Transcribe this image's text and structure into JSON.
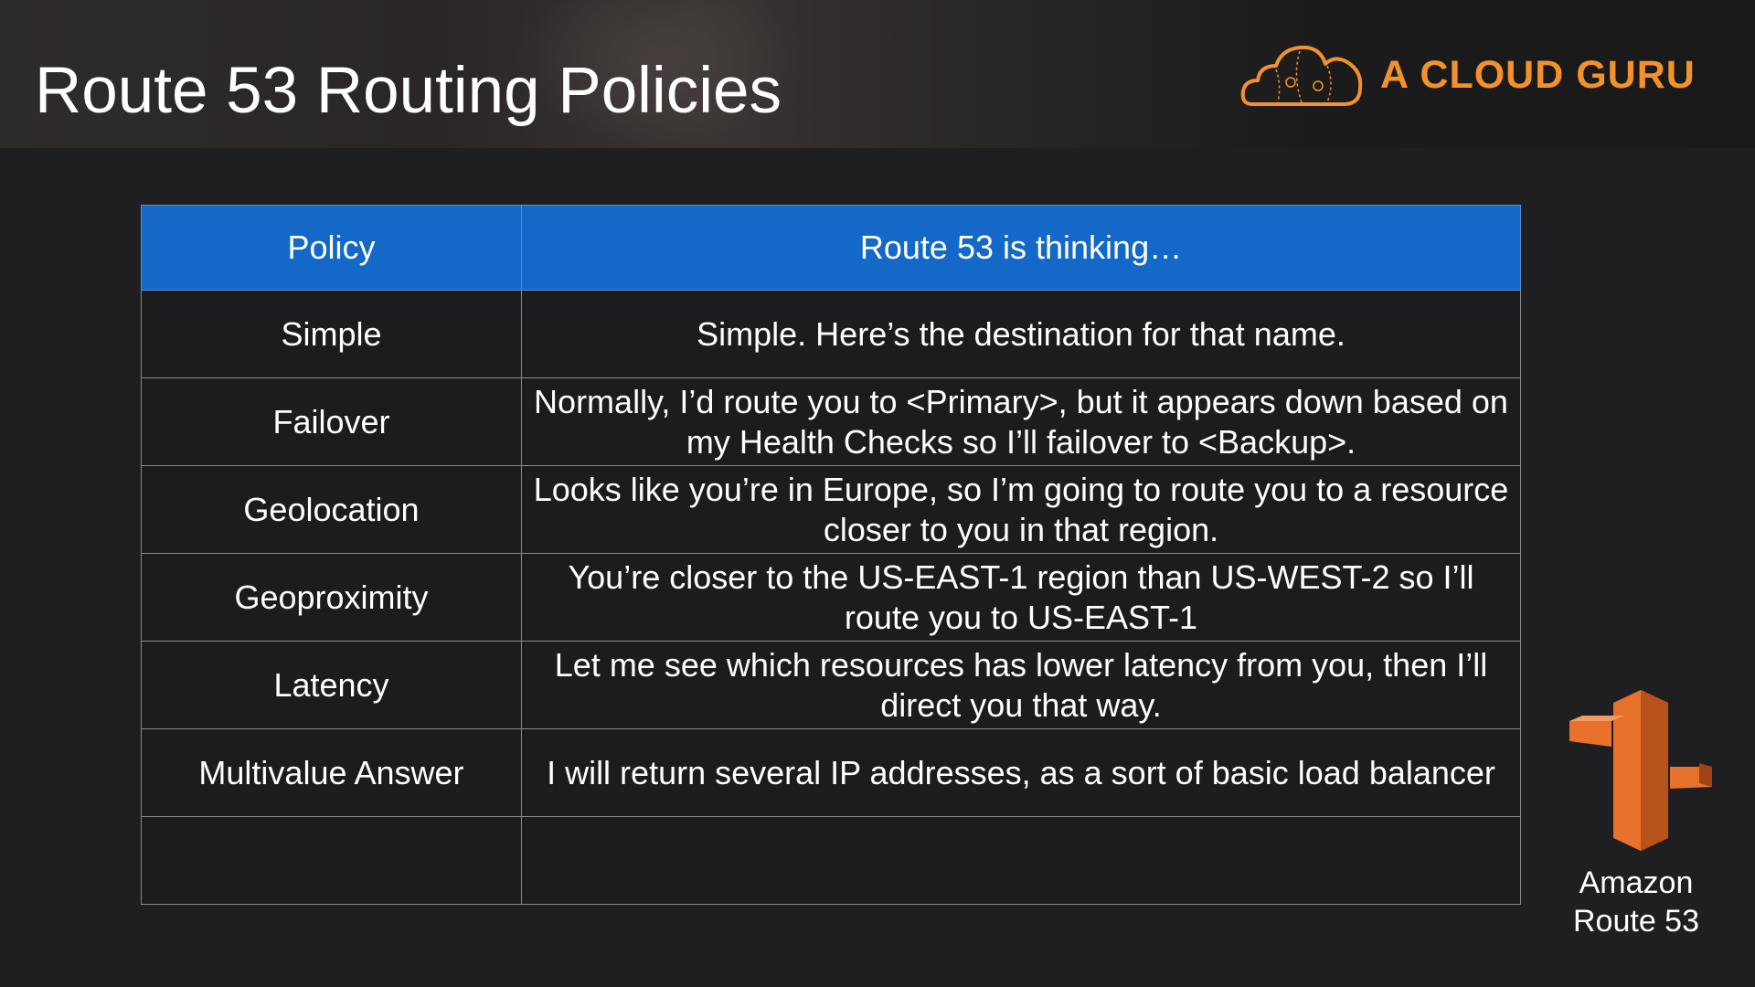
{
  "title": "Route 53 Routing Policies",
  "brand": {
    "name": "A CLOUD GURU",
    "color": "#f3922b",
    "icon": "cloud-logo-icon"
  },
  "table": {
    "headers": [
      "Policy",
      "Route 53 is thinking…"
    ],
    "header_color": "#1468c7",
    "rows": [
      {
        "policy": "Simple",
        "description": "Simple.  Here’s the destination for that name."
      },
      {
        "policy": "Failover",
        "description": "Normally, I’d route you to <Primary>, but it appears down based on my Health Checks so I’ll failover to <Backup>."
      },
      {
        "policy": "Geolocation",
        "description": "Looks like you’re in Europe, so I’m going to route you to a resource closer to you in that region."
      },
      {
        "policy": "Geoproximity",
        "description": "You’re closer to the US-EAST-1 region than US-WEST-2 so I’ll route you to US-EAST-1"
      },
      {
        "policy": "Latency",
        "description": "Let me see which resources has lower latency from you, then I’ll direct you that way."
      },
      {
        "policy": "Multivalue Answer",
        "description": "I will return several IP addresses, as a sort of basic load balancer"
      },
      {
        "policy": "",
        "description": ""
      }
    ]
  },
  "service": {
    "label_line1": "Amazon",
    "label_line2": "Route 53",
    "icon": "route53-icon",
    "color": "#e8712c"
  }
}
